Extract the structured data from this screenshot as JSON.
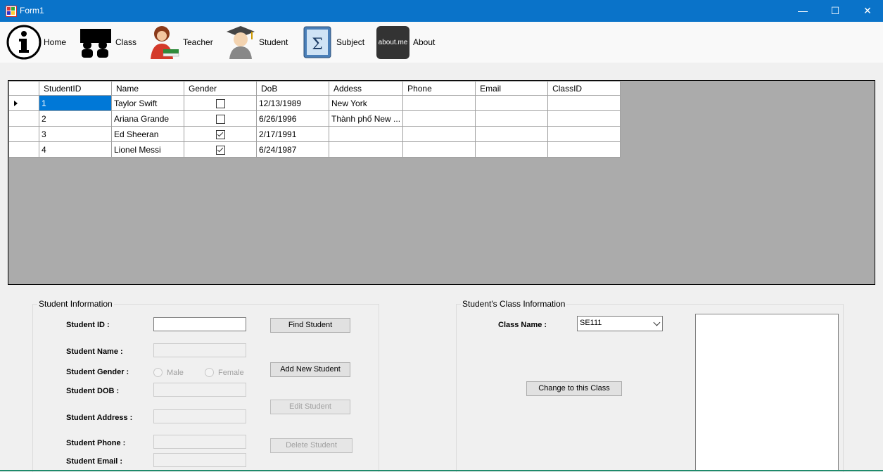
{
  "window": {
    "title": "Form1",
    "minimize_glyph": "—",
    "maximize_glyph": "☐",
    "close_glyph": "✕"
  },
  "toolbar": {
    "items": [
      {
        "label": "Home",
        "icon": "info-icon"
      },
      {
        "label": "Class",
        "icon": "class-icon"
      },
      {
        "label": "Teacher",
        "icon": "teacher-icon"
      },
      {
        "label": "Student",
        "icon": "student-icon"
      },
      {
        "label": "Subject",
        "icon": "subject-icon"
      },
      {
        "label": "About",
        "icon": "about-me-icon",
        "icon_text": "about.me"
      }
    ]
  },
  "grid": {
    "columns": [
      "StudentID",
      "Name",
      "Gender",
      "DoB",
      "Addess",
      "Phone",
      "Email",
      "ClassID"
    ],
    "rows": [
      {
        "id": "1",
        "name": "Taylor Swift",
        "gender": false,
        "dob": "12/13/1989",
        "address": "New York",
        "phone": "",
        "email": "",
        "classid": ""
      },
      {
        "id": "2",
        "name": "Ariana Grande",
        "gender": false,
        "dob": "6/26/1996",
        "address": "Thành phố New ...",
        "phone": "",
        "email": "",
        "classid": ""
      },
      {
        "id": "3",
        "name": "Ed Sheeran",
        "gender": true,
        "dob": "2/17/1991",
        "address": "",
        "phone": "",
        "email": "",
        "classid": ""
      },
      {
        "id": "4",
        "name": "Lionel Messi",
        "gender": true,
        "dob": "6/24/1987",
        "address": "",
        "phone": "",
        "email": "",
        "classid": ""
      }
    ]
  },
  "student_info": {
    "legend": "Student Information",
    "id_label": "Student ID :",
    "name_label": "Student Name :",
    "gender_label": "Student Gender :",
    "male_label": "Male",
    "female_label": "Female",
    "dob_label": "Student DOB :",
    "address_label": "Student Address :",
    "phone_label": "Student Phone :",
    "email_label": "Student Email :",
    "find_button": "Find Student",
    "add_button": "Add New Student",
    "edit_button": "Edit Student",
    "delete_button": "Delete Student"
  },
  "class_info": {
    "legend": "Student's Class Information",
    "class_name_label": "Class Name :",
    "class_selected": "SE111",
    "change_button": "Change to this Class"
  }
}
